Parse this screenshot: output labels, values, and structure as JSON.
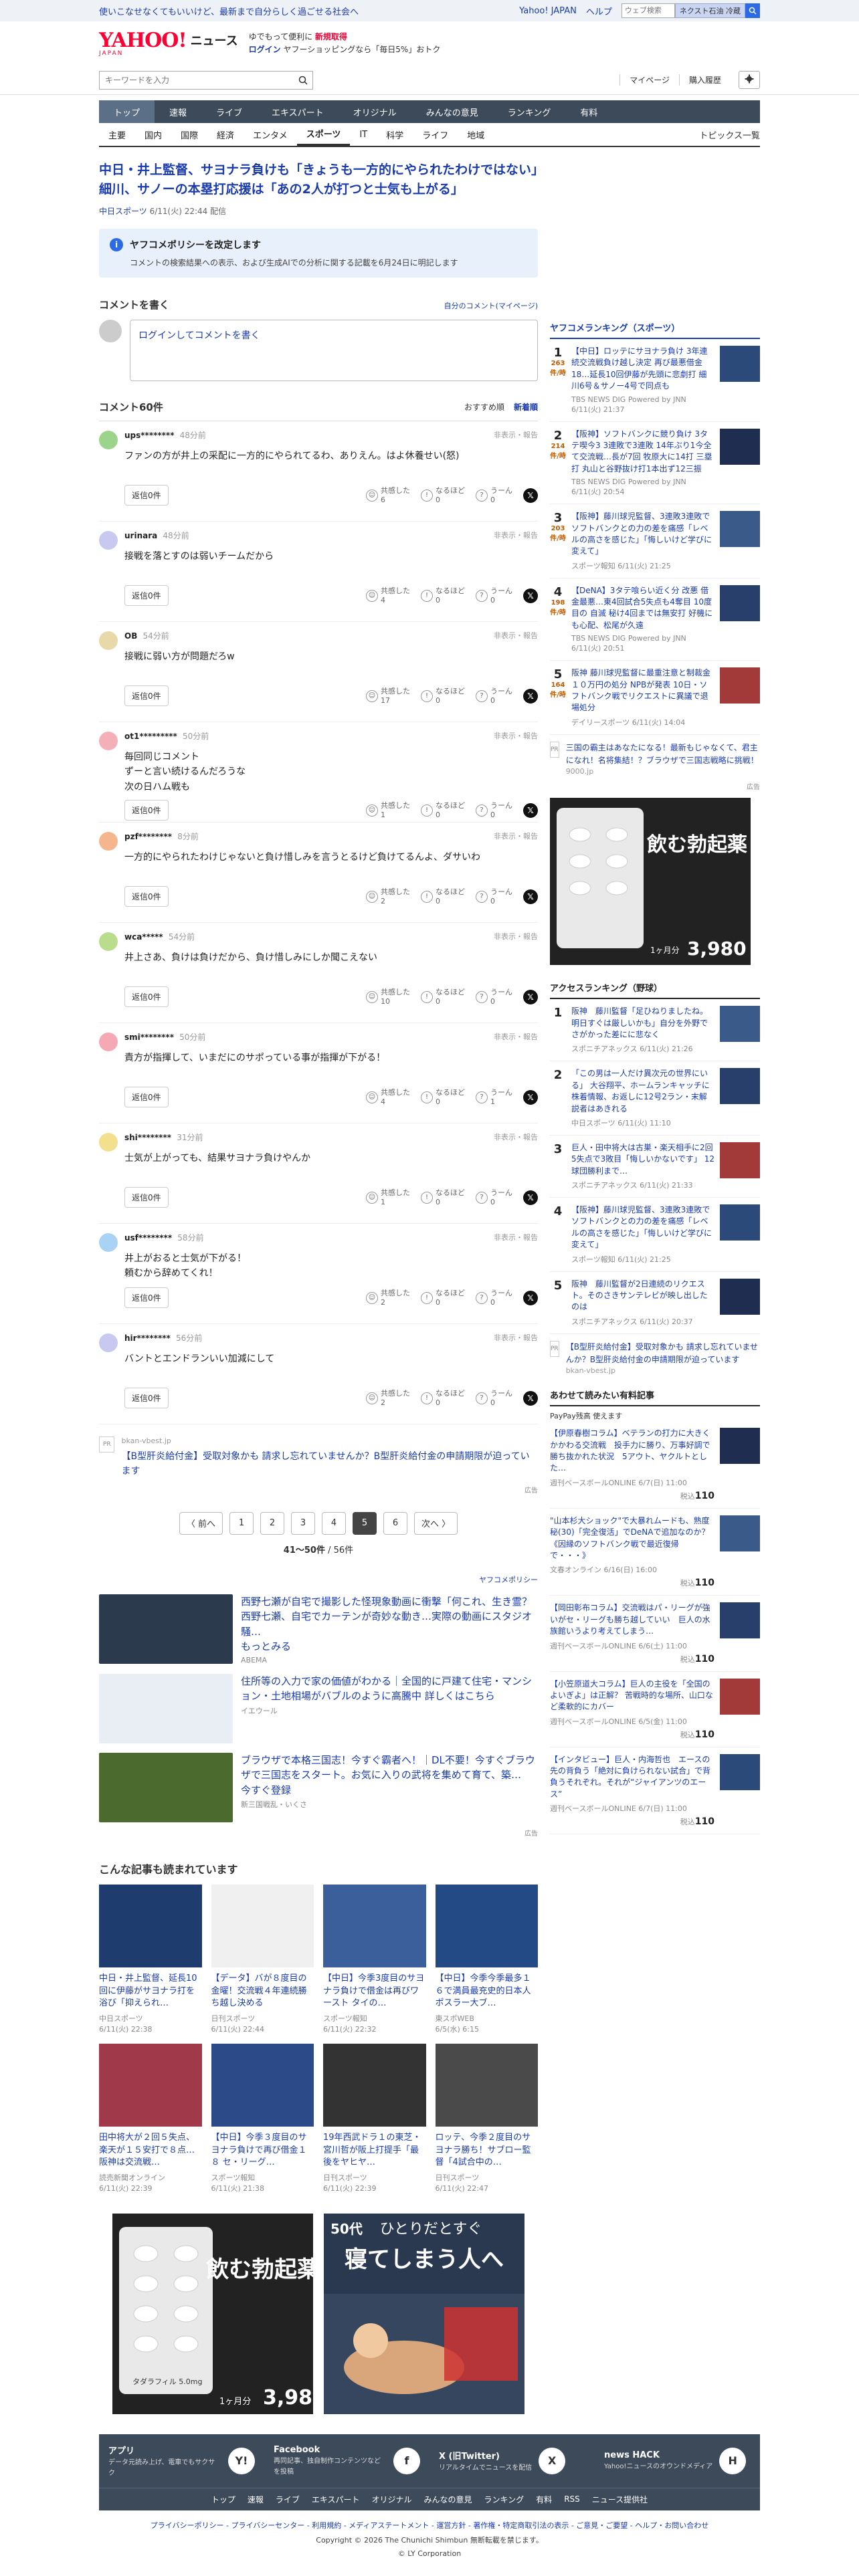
{
  "topbar": {
    "notice": "使いこなせなくてもいいけど、最新まで自分らしく過ごせる社会へ",
    "yahoo_japan": "Yahoo! JAPAN",
    "help": "ヘルプ",
    "mini_placeholder": "ウェブ検索",
    "search_label": "ネクスト石油 冷蔵"
  },
  "brand": {
    "logo": "YAHOO!",
    "logo_sub": "JAPAN",
    "section": "ニュース",
    "promo_line1_a": "ゆでもって便利に",
    "promo_line1_b": "新規取得",
    "promo_line2_a": "ログイン",
    "promo_line2_b": "ヤフーショッピングなら「毎日5%」おトク"
  },
  "search": {
    "placeholder": "キーワードを入力",
    "mypage": "マイページ",
    "history": "購入履歴"
  },
  "gnav": [
    "トップ",
    "速報",
    "ライブ",
    "エキスパート",
    "オリジナル",
    "みんなの意見",
    "ランキング",
    "有料"
  ],
  "subnav": [
    "主要",
    "国内",
    "国際",
    "経済",
    "エンタメ",
    "スポーツ",
    "IT",
    "科学",
    "ライフ",
    "地域"
  ],
  "subnav_right": "トピックス一覧",
  "article": {
    "title": "中日・井上監督、サヨナラ負けも「きょうも一方的にやられたわけではない」細川、サノーの本塁打応援は「あの2人が打つと士気も上がる」",
    "publisher": "中日スポーツ",
    "date": "6/11(火) 22:44 配信"
  },
  "policy": {
    "title": "ヤフコメポリシーを改定します",
    "text": "コメントの検索結果への表示、および生成AIでの分析に関する記載を6月24日に明記します"
  },
  "comment_write": {
    "title": "コメントを書く",
    "mine": "自分のコメント(マイページ)",
    "prompt": "ログインしてコメントを書く"
  },
  "comments_head": {
    "title": "コメント60件",
    "sort_a": "おすすめ順",
    "sort_b": "新着順"
  },
  "labels": {
    "report": "非表示・報告",
    "reply": "返信0件",
    "agree": "共感した",
    "think": "なるほど",
    "hmm": "うーん"
  },
  "comments": [
    {
      "user": "ups********",
      "time": "48分前",
      "text": "ファンの方が井上の采配に一方的にやられてるわ、ありえん。はよ休養せい(怒)",
      "agree": "6",
      "think": "0",
      "hmm": "0",
      "color": "#9bd48a"
    },
    {
      "user": "urinara",
      "time": "48分前",
      "text": "接戦を落とすのは弱いチームだから",
      "agree": "4",
      "think": "0",
      "hmm": "0",
      "color": "#c7c9f0"
    },
    {
      "user": "OB",
      "time": "54分前",
      "text": "接戦に弱い方が問題だろw",
      "agree": "17",
      "think": "0",
      "hmm": "0",
      "color": "#e7d9a8"
    },
    {
      "user": "ot1*********",
      "time": "50分前",
      "text": "毎回同じコメント\nずーと言い続けるんだろうな\n次の日ハム戦も",
      "agree": "1",
      "think": "0",
      "hmm": "0",
      "color": "#f3b0b8"
    },
    {
      "user": "pzf********",
      "time": "8分前",
      "text": "一方的にやられたわけじゃないと負け惜しみを言うとるけど負けてるんよ、ダサいわ",
      "agree": "2",
      "think": "0",
      "hmm": "0",
      "color": "#f5b68e"
    },
    {
      "user": "wca*****",
      "time": "54分前",
      "text": "井上さあ、負けは負けだから、負け惜しみにしか聞こえない",
      "agree": "10",
      "think": "0",
      "hmm": "0",
      "color": "#b9dd8c"
    },
    {
      "user": "smi********",
      "time": "50分前",
      "text": "責方が指揮して、いまだにのサポっている事が指揮が下がる！",
      "agree": "4",
      "think": "0",
      "hmm": "1",
      "color": "#f4a9b4"
    },
    {
      "user": "shi********",
      "time": "31分前",
      "text": "士気が上がっても、結果サヨナラ負けやんか",
      "agree": "1",
      "think": "0",
      "hmm": "0",
      "color": "#f3e08e"
    },
    {
      "user": "usf********",
      "time": "58分前",
      "text": "井上がおると士気が下がる！\n頼むから辞めてくれ！",
      "agree": "2",
      "think": "0",
      "hmm": "0",
      "color": "#a9d2f5"
    },
    {
      "user": "hir********",
      "time": "56分前",
      "text": "バントとエンドランいい加減にして",
      "agree": "2",
      "think": "0",
      "hmm": "0",
      "color": "#c7c9f0"
    }
  ],
  "pr_comment": {
    "tag": "PR",
    "src": "bkan-vbest.jp",
    "title": "【B型肝炎給付金】受取対象かも 請求し忘れていませんか？B型肝炎給付金の申請期限が迫っています",
    "ad": "広告"
  },
  "pager": {
    "prev": "〈 前へ",
    "next": "次へ 〉",
    "pages": [
      "1",
      "2",
      "3",
      "4",
      "5",
      "6"
    ],
    "current": "5",
    "count_a": "41〜50件",
    "count_b": "56件"
  },
  "adpolicy": "ヤフコメポリシー",
  "promos": [
    {
      "title": "西野七瀬が自宅で撮影した怪現象動画に衝撃「何これ、生き霊？西野七瀬、自宅でカーテンが奇妙な動き…実際の動画にスタジオ騒…",
      "more": "もっとみる",
      "src": "ABEMA",
      "color": "#2c3a4e"
    },
    {
      "title": "住所等の入力で家の価値がわかる｜全国的に戸建て住宅・マンション・土地相場がバブルのように高騰中 詳しくはこちら",
      "more": "",
      "src": "イエウール",
      "color": "#e9eef4"
    },
    {
      "title": "ブラウザで本格三国志！今すぐ霸者へ！｜DL不要！今すぐブラウザで三国志をスタート。お気に入りの武将を集めて育て、築…",
      "more": "今すぐ登録",
      "src": "新三国戦乱・いくさ",
      "color": "#4a6a2e"
    }
  ],
  "promo_ad": "広告",
  "related": {
    "title": "こんな記事も読まれています",
    "items": [
      {
        "t": "中日・井上監督、延長10回に伊藤がサヨナラ打を浴び「抑えられ…",
        "s": "中日スポーツ",
        "d": "6/11(火) 22:38",
        "c": "#1f3c6e"
      },
      {
        "t": "【データ】バが８度目の金曜！交流戦４年連続勝ち越し決める",
        "s": "日刊スポーツ",
        "d": "6/11(火) 22:44",
        "c": "#f0f0f0"
      },
      {
        "t": "【中日】今季3度目のサヨナラ負けで借金は再びワースト タイの…",
        "s": "スポーツ報知",
        "d": "6/11(火) 22:32",
        "c": "#3a5f9a"
      },
      {
        "t": "【中日】今季今季最多１６で満員最充史的日本人ポスラー大ブ…",
        "s": "東スポWEB",
        "d": "6/5(水) 6:15",
        "c": "#244a86"
      },
      {
        "t": "田中将大が２回５失点、楽天が１５安打で８点…阪神は交流戦…",
        "s": "読売新聞オンライン",
        "d": "6/11(火) 22:39",
        "c": "#a03a4a"
      },
      {
        "t": "【中日】今季３度目のサヨナラ負けで再び借金１８ セ・リーグ…",
        "s": "スポーツ報知",
        "d": "6/11(火) 21:38",
        "c": "#2d4a88"
      },
      {
        "t": "19年西武ドラ１の東芝・宮川哲が阪上打提手「最後をヤヒヤ…",
        "s": "日刊スポーツ",
        "d": "6/11(火) 22:39",
        "c": "#333333"
      },
      {
        "t": "ロッテ、今季２度目のサヨナラ勝ち！サブロー監督「4試合中の…",
        "s": "日刊スポーツ",
        "d": "6/11(火) 22:47",
        "c": "#4a4a4a"
      }
    ]
  },
  "side_ranking": {
    "title": "ヤフコメランキング（スポーツ）",
    "items": [
      {
        "n": "1",
        "c": "263",
        "unit": "件/時",
        "t": "【中日】ロッテにサヨナラ負け 3年連続交流戦負け越し決定 再び最悪借金18…延長10回伊藤が先頭に悲劇打 細川6号＆サノー4号で同点も",
        "m": "TBS NEWS DIG Powered by JNN 6/11(火) 21:37"
      },
      {
        "n": "2",
        "c": "214",
        "unit": "件/時",
        "t": "【阪神】ソフトバンクに競り負け 3タテ喫今3 3連敗で3連敗 14年ぶり1今全て交流戦…長が7回 牧原大に14打 三塁打 丸山と谷野抜け打1本出ず12三振",
        "m": "TBS NEWS DIG Powered by JNN 6/11(火) 20:54"
      },
      {
        "n": "3",
        "c": "203",
        "unit": "件/時",
        "t": "【阪神】藤川球児監督、3連敗3連敗でソフトバンクとの力の差を痛感「レベルの高さを感じた」「悔しいけど学びに変えて」",
        "m": "スポーツ報知 6/11(火) 21:25"
      },
      {
        "n": "4",
        "c": "198",
        "unit": "件/時",
        "t": "【DeNA】3タテ喰らい近く分 改悪 借金最悪…東4回試合5失点も4奪目 10度目の 自滅 秘け4回までは無安打 好機にも心配、松尾が久遠",
        "m": "TBS NEWS DIG Powered by JNN 6/11(火) 20:51"
      },
      {
        "n": "5",
        "c": "164",
        "unit": "件/時",
        "t": "阪神 藤川球児監督に最重注意と制裁金１０万円の処分 NPBが発表 10日・ソフトバンク戦でリクエストに異議で退場処分",
        "m": "デイリースポーツ 6/11(火) 14:04"
      }
    ]
  },
  "side_pr": {
    "tag": "PR",
    "title": "三国の霸主はあなたになる！最新もじゃなくて、君主になれ！名将集結！？ブラウザで三国志戦略に挑戦！",
    "src": "9000.jp"
  },
  "side_ad_label": "広告",
  "ad_pill": {
    "text": "飲む勃起薬",
    "price": "3,980",
    "price_unit": "円",
    "prefix": "1ヶ月分",
    "brand": "タダラフィル 5.0mg"
  },
  "access_ranking": {
    "title": "アクセスランキング（野球）",
    "items": [
      {
        "n": "1",
        "t": "阪神　藤川監督「足ひねりましたね。明日すぐは厳しいかも」自分を外野でさがかった差にに悲なく",
        "m": "スポニチアネックス 6/11(火) 21:26"
      },
      {
        "n": "2",
        "t": "「この男は一人だけ異次元の世界にいる」 大谷翔平、ホームランキャッチに株着情報、お返しに12号2ラン・末解説者はあきれる",
        "m": "中日スポーツ 6/11(火) 11:10"
      },
      {
        "n": "3",
        "t": "巨人・田中将大は古巣・楽天相手に2回5失点で3敗目「悔しいかないです」 12球団勝利まで…",
        "m": "スポニチアネックス 6/11(火) 21:33"
      },
      {
        "n": "4",
        "t": "【阪神】藤川球児監督、3連敗3連敗でソフトバンクとの力の差を痛感「レベルの高さを感じた」「悔しいけど学びに変えて」",
        "m": "スポーツ報知 6/11(火) 21:25"
      },
      {
        "n": "5",
        "t": "阪神　藤川監督が2日連続のリクエスト。そのさきサンテレビが映し出したのは",
        "m": "スポニチアネックス 6/11(火) 20:37"
      }
    ]
  },
  "access_pr": {
    "tag": "PR",
    "title": "【B型肝炎給付金】受取対象かも 請求し忘れていませんか？B型肝炎給付金の申請期限が迫っています",
    "src": "bkan-vbest.jp"
  },
  "paid": {
    "title": "あわせて読みたい有料記事",
    "sub": "PayPay残高 使えます",
    "price_label": "税込",
    "items": [
      {
        "t": "【伊原春樹コラム】ベテランの打力に大きくかかわる交流戦　投手力に勝り、万事好調で勝ち抜かれた状況　5アウト、ヤクルトとした…",
        "m": "週刊ベースボールONLINE 6/7(日) 11:00",
        "p": "110"
      },
      {
        "t": "\"山本杉大ショック\"で大暴れムードも、熟度秘(30)「完全復活」でDeNAで追加なのか？　《因縁のソフトバンク戦で最近復帰で・・・》",
        "m": "文春オンライン 6/16(日) 16:00",
        "p": "110"
      },
      {
        "t": "【岡田彰布コラム】交流戦はパ・リーグが強いがセ・リーグも勝ち越していい　巨人の水族館いうより考えてしまう…",
        "m": "週刊ベースボールONLINE 6/6(土) 11:00",
        "p": "110"
      },
      {
        "t": "【小笠原道大コラム】巨人の主役を「全国のよいぎよ」は正解？ 苦戦時的な場所、山口など柔軟的にカバー",
        "m": "週刊ベースボールONLINE 6/5(金) 11:00",
        "p": "110"
      },
      {
        "t": "【インタビュー】巨人・内海哲也　エースの先の背負う「絶対に負けられない試合」で背負うそれぞれ。それが“ジャイアンツのエース”",
        "m": "週刊ベースボールONLINE 6/7(日) 11:00",
        "p": "110"
      }
    ]
  },
  "big_ad_2": {
    "age": "50代",
    "text_a": "ひとりだとすぐ",
    "text_b": "寝てしまう人へ"
  },
  "footer_apps": [
    {
      "name": "アプリ",
      "desc": "データ元読み上げ、電車でもサクサク",
      "icon": "Y!"
    },
    {
      "name": "Facebook",
      "desc": "再同記事、独自制作コンテンツなどを投稿",
      "icon": "f"
    },
    {
      "name": "X (旧Twitter)",
      "desc": "リアルタイムでニュースを配信",
      "icon": "X"
    },
    {
      "name": "news HACK",
      "desc": "Yahoo!ニュースのオウンドメディア",
      "icon": "H"
    }
  ],
  "footer_nav": [
    "トップ",
    "速報",
    "ライブ",
    "エキスパート",
    "オリジナル",
    "みんなの意見",
    "ランキング",
    "有料",
    "RSS",
    "ニュース提供社"
  ],
  "legal": "プライバシーポリシー - プライバシーセンター - 利用規約 - メディアステートメント - 運営方針 - 著作権・特定商取引法の表示 - ご意見・ご要望 - ヘルプ・お問い合わせ",
  "copyright_a": "Copyright © 2026 The Chunichi Shimbun 無断転載を禁じます。",
  "copyright_b": "© LY Corporation",
  "colors": {
    "link": "#1a3bb0",
    "nav": "#3c4a5a",
    "brand_red": "#ff0033"
  }
}
